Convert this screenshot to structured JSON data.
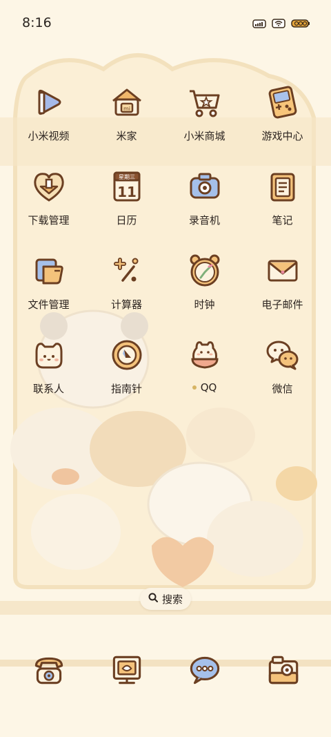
{
  "status_bar": {
    "time": "8:16",
    "icons": [
      "signal-icon",
      "wifi-icon",
      "battery-icon"
    ],
    "battery_text": "100"
  },
  "apps": [
    {
      "label": "小米视频",
      "icon": "video-play-icon"
    },
    {
      "label": "米家",
      "icon": "home-icon"
    },
    {
      "label": "小米商城",
      "icon": "shopping-cart-icon"
    },
    {
      "label": "游戏中心",
      "icon": "gamepad-icon"
    },
    {
      "label": "下载管理",
      "icon": "download-heart-icon"
    },
    {
      "label": "日历",
      "icon": "calendar-icon",
      "calendar_header": "星期三",
      "calendar_day": "11"
    },
    {
      "label": "录音机",
      "icon": "recorder-icon"
    },
    {
      "label": "笔记",
      "icon": "notes-icon"
    },
    {
      "label": "文件管理",
      "icon": "folder-icon"
    },
    {
      "label": "计算器",
      "icon": "calculator-icon"
    },
    {
      "label": "时钟",
      "icon": "clock-icon"
    },
    {
      "label": "电子邮件",
      "icon": "email-icon"
    },
    {
      "label": "联系人",
      "icon": "contacts-icon"
    },
    {
      "label": "指南针",
      "icon": "compass-icon"
    },
    {
      "label": "QQ",
      "icon": "qq-icon",
      "new_dot": true
    },
    {
      "label": "微信",
      "icon": "wechat-icon"
    }
  ],
  "search": {
    "label": "搜索",
    "icon": "search-icon"
  },
  "dock": [
    {
      "icon": "phone-icon"
    },
    {
      "icon": "gallery-icon"
    },
    {
      "icon": "messages-icon"
    },
    {
      "icon": "camera-icon"
    }
  ],
  "colors": {
    "background": "#fdf6e6",
    "icon_stroke": "#6b3f22",
    "accent_blue": "#7f9fd6",
    "accent_orange": "#f0b76b"
  }
}
